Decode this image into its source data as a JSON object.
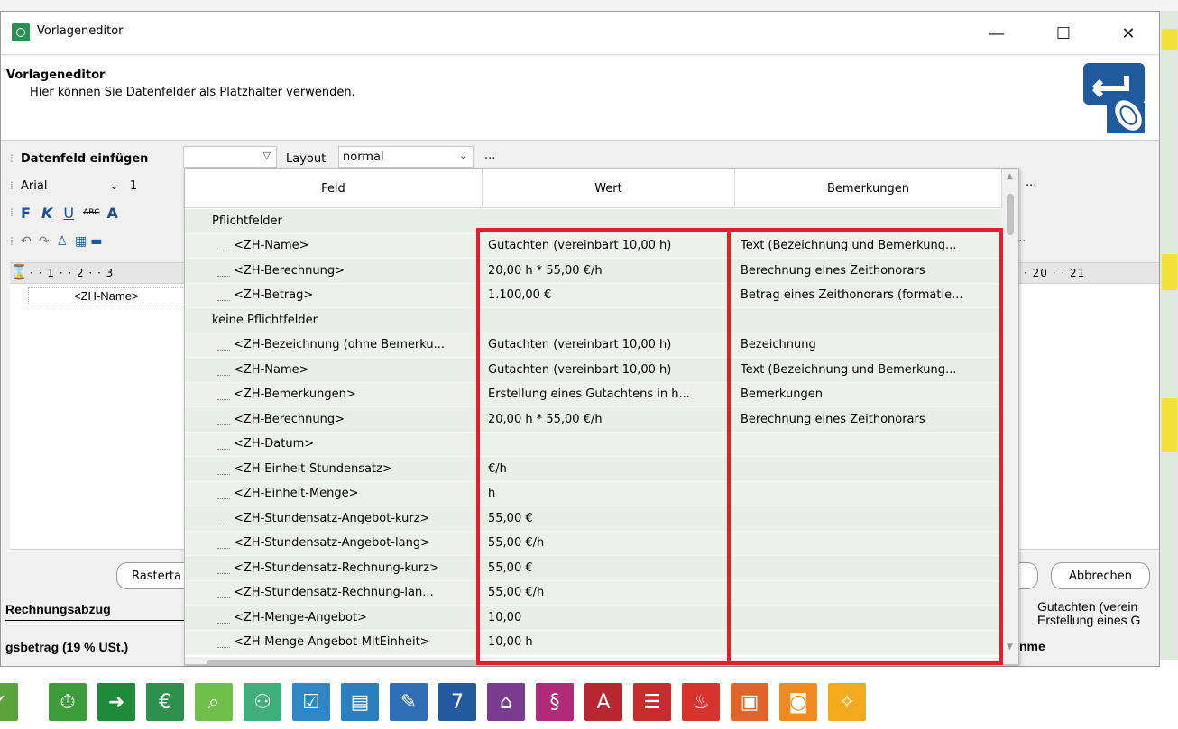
{
  "window": {
    "title": "Vorlageneditor",
    "minimize": "—",
    "maximize": "☐",
    "close": "✕"
  },
  "header": {
    "title": "Vorlageneditor",
    "subtitle": "Hier können Sie Datenfelder als Platzhalter verwenden."
  },
  "toolbar": {
    "insert_field_label": "Datenfeld einfügen",
    "layout_label": "Layout",
    "layout_value": "normal",
    "more": "···",
    "font_name": "Arial",
    "font_size_partial": "1",
    "bold": "F",
    "italic": "K",
    "underline": "U",
    "strike": "ABC",
    "font_color": "A"
  },
  "ruler": {
    "left_ticks": "· · 1 · · 2 · · 3",
    "right_ticks": "· 20 · · 21"
  },
  "document": {
    "cell_text": "<ZH-Name>"
  },
  "buttons": {
    "grid_partial": "Rasterta",
    "cancel": "Abbrechen"
  },
  "table": {
    "columns": [
      "Feld",
      "Wert",
      "Bemerkungen"
    ],
    "rows": [
      {
        "feld": "Pflichtfelder",
        "wert": "",
        "bem": "",
        "kind": "group"
      },
      {
        "feld": "<ZH-Name>",
        "wert": "Gutachten (vereinbart 10,00 h)",
        "bem": "Text (Bezeichnung und Bemerkung...",
        "kind": "child"
      },
      {
        "feld": "<ZH-Berechnung>",
        "wert": "20,00 h * 55,00 €/h",
        "bem": "Berechnung eines Zeithonorars",
        "kind": "child"
      },
      {
        "feld": "<ZH-Betrag>",
        "wert": "1.100,00 €",
        "bem": "Betrag eines Zeithonorars (formatie...",
        "kind": "child"
      },
      {
        "feld": "keine Pflichtfelder",
        "wert": "",
        "bem": "",
        "kind": "group"
      },
      {
        "feld": "<ZH-Bezeichnung (ohne Bemerku...",
        "wert": "Gutachten (vereinbart 10,00 h)",
        "bem": "Bezeichnung",
        "kind": "child"
      },
      {
        "feld": "<ZH-Name>",
        "wert": "Gutachten (vereinbart 10,00 h)",
        "bem": "Text (Bezeichnung und Bemerkung...",
        "kind": "child"
      },
      {
        "feld": "<ZH-Bemerkungen>",
        "wert": "Erstellung eines Gutachtens in h...",
        "bem": "Bemerkungen",
        "kind": "child"
      },
      {
        "feld": "<ZH-Berechnung>",
        "wert": "20,00 h * 55,00 €/h",
        "bem": "Berechnung eines Zeithonorars",
        "kind": "child"
      },
      {
        "feld": "<ZH-Datum>",
        "wert": "",
        "bem": "",
        "kind": "child"
      },
      {
        "feld": "<ZH-Einheit-Stundensatz>",
        "wert": "€/h",
        "bem": "",
        "kind": "child"
      },
      {
        "feld": "<ZH-Einheit-Menge>",
        "wert": "h",
        "bem": "",
        "kind": "child"
      },
      {
        "feld": "<ZH-Stundensatz-Angebot-kurz>",
        "wert": "55,00 €",
        "bem": "",
        "kind": "child"
      },
      {
        "feld": "<ZH-Stundensatz-Angebot-lang>",
        "wert": "55,00 €/h",
        "bem": "",
        "kind": "child"
      },
      {
        "feld": "<ZH-Stundensatz-Rechnung-kurz>",
        "wert": "55,00 €",
        "bem": "",
        "kind": "child"
      },
      {
        "feld": "<ZH-Stundensatz-Rechnung-lan...",
        "wert": "55,00 €/h",
        "bem": "",
        "kind": "child"
      },
      {
        "feld": "<ZH-Menge-Angebot>",
        "wert": "10,00",
        "bem": "",
        "kind": "child"
      },
      {
        "feld": "<ZH-Menge-Angebot-MitEinheit>",
        "wert": "10,00 h",
        "bem": "",
        "kind": "child"
      }
    ]
  },
  "background": {
    "left_row1": "Rechnungsabzug",
    "left_row2": "gsbetrag (19 % USt.)",
    "right_line1": "Gutachten (verein",
    "right_line2": "Erstellung eines G",
    "right_line3": "nme"
  },
  "taskbar_icons": [
    {
      "name": "leaf-icon",
      "color": "#5aa33a",
      "glyph": "✓"
    },
    {
      "name": "stopwatch-icon",
      "color": "#3c9c3a",
      "glyph": "⏱"
    },
    {
      "name": "arrow-right-icon",
      "color": "#1f8a3c",
      "glyph": "➜"
    },
    {
      "name": "euro-icon",
      "color": "#2e8f4f",
      "glyph": "€"
    },
    {
      "name": "search-icon",
      "color": "#6fbf4a",
      "glyph": "⌕"
    },
    {
      "name": "people-icon",
      "color": "#3fae7a",
      "glyph": "⚇"
    },
    {
      "name": "checklist-icon",
      "color": "#2f86c7",
      "glyph": "☑"
    },
    {
      "name": "folder-icon",
      "color": "#2a7fc0",
      "glyph": "▤"
    },
    {
      "name": "edit-icon",
      "color": "#2f6fb5",
      "glyph": "✎"
    },
    {
      "name": "calendar-icon",
      "color": "#235a9e",
      "glyph": "7"
    },
    {
      "name": "graduation-icon",
      "color": "#7a3c8f",
      "glyph": "⌂"
    },
    {
      "name": "paragraph-icon",
      "color": "#b02a77",
      "glyph": "§"
    },
    {
      "name": "text-a-icon",
      "color": "#b8262f",
      "glyph": "A"
    },
    {
      "name": "gantt-icon",
      "color": "#c62c2c",
      "glyph": "☰"
    },
    {
      "name": "flame-icon",
      "color": "#d8322c",
      "glyph": "♨"
    },
    {
      "name": "certificate-icon",
      "color": "#e0632a",
      "glyph": "▣"
    },
    {
      "name": "badge-icon",
      "color": "#f08c1f",
      "glyph": "◙"
    },
    {
      "name": "runner-icon",
      "color": "#f2a91c",
      "glyph": "✧"
    }
  ]
}
